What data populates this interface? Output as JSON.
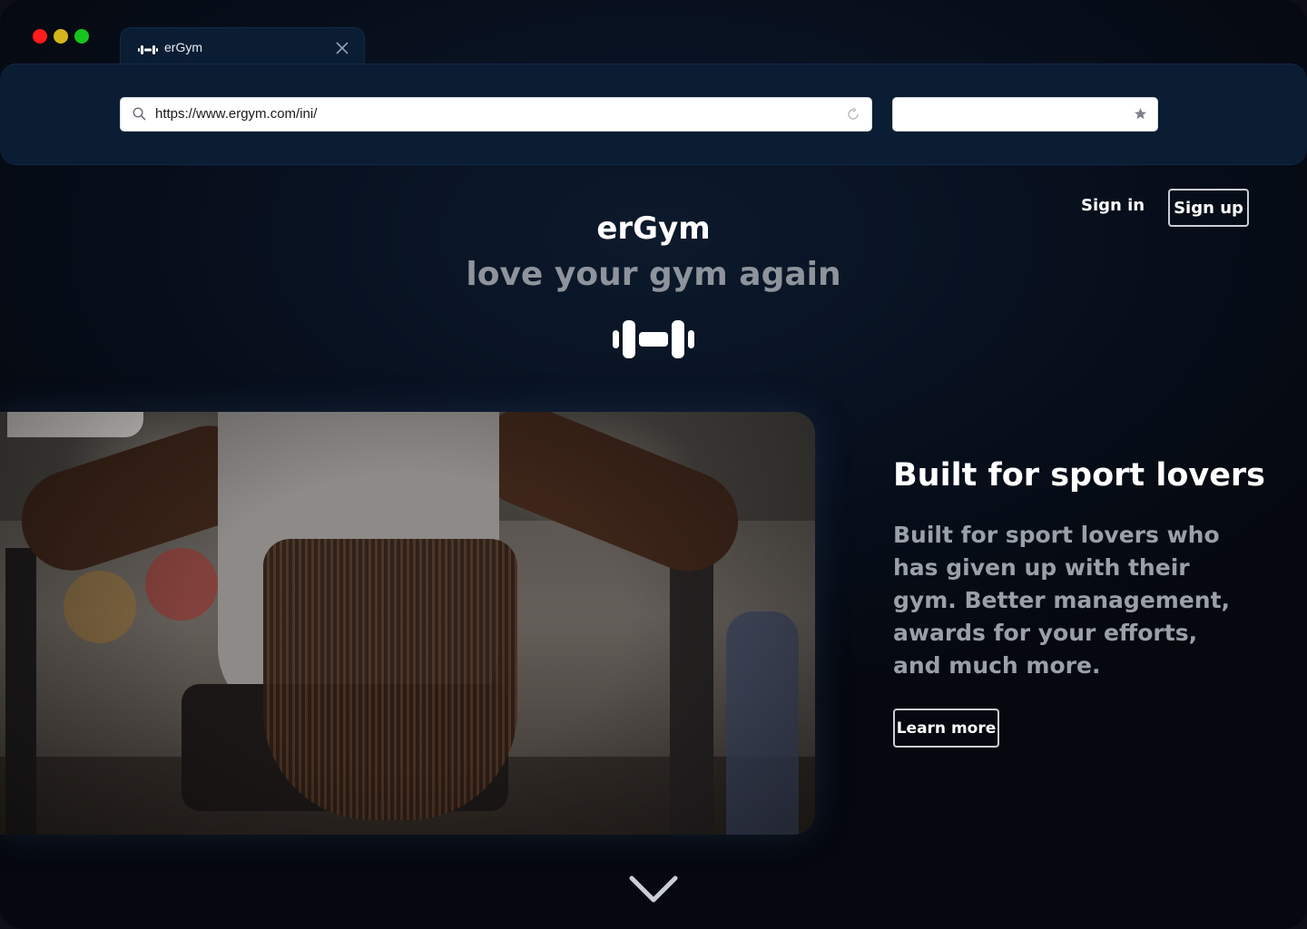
{
  "browser": {
    "tab": {
      "title": "erGym",
      "icon": "dumbbell-icon"
    },
    "address_bar": {
      "url": "https://www.ergym.com/ini/",
      "search_icon": "search-icon",
      "reload_icon": "reload-icon"
    },
    "bookmark_bar": {
      "value": "",
      "star_icon": "star-icon"
    },
    "traffic_lights": {
      "close_color": "#ff1c1c",
      "minimize_color": "#d4b51a",
      "maximize_color": "#18c21f"
    }
  },
  "nav": {
    "signin_label": "Sign in",
    "signup_label": "Sign up"
  },
  "hero": {
    "brand": "erGym",
    "tagline": "love your gym again",
    "logo_icon": "dumbbell-icon"
  },
  "feature": {
    "title": "Built for sport lovers",
    "body": "Built for sport lovers who has given up with their gym. Better management, awards for your efforts, and much more.",
    "cta_label": "Learn more"
  },
  "scroll": {
    "icon": "chevron-down-icon"
  },
  "colors": {
    "background": "#05080e",
    "toolbar": "#0b1d33",
    "text_primary": "#ffffff",
    "text_secondary": "#9aa0a8"
  }
}
